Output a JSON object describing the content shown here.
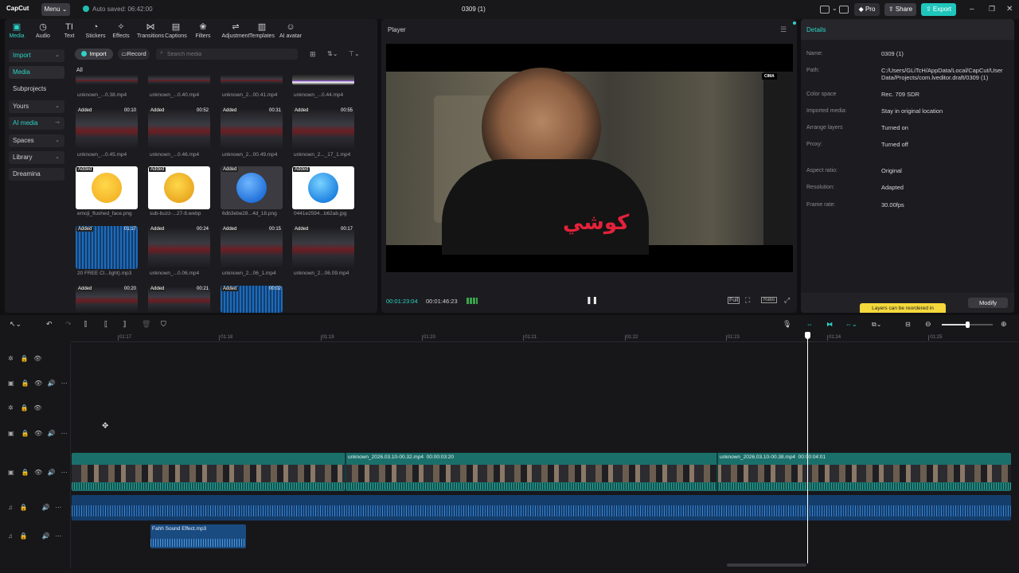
{
  "app": {
    "logo": "CapCut",
    "menu": "Menu",
    "autosave": "Auto saved: 06:42:00",
    "project_title": "0309 (1)",
    "pro": "Pro",
    "share": "Share",
    "export": "Export"
  },
  "toolbar": {
    "items": [
      {
        "label": "Media",
        "icon": "media-icon"
      },
      {
        "label": "Audio",
        "icon": "audio-icon"
      },
      {
        "label": "Text",
        "icon": "text-icon"
      },
      {
        "label": "Stickers",
        "icon": "stickers-icon"
      },
      {
        "label": "Effects",
        "icon": "effects-icon"
      },
      {
        "label": "Transitions",
        "icon": "transitions-icon"
      },
      {
        "label": "Captions",
        "icon": "captions-icon"
      },
      {
        "label": "Filters",
        "icon": "filters-icon"
      },
      {
        "label": "Adjustment",
        "icon": "adjustment-icon"
      },
      {
        "label": "Templates",
        "icon": "templates-icon"
      },
      {
        "label": "AI avatar",
        "icon": "ai-avatar-icon"
      }
    ]
  },
  "sidebar": {
    "items": [
      {
        "label": "Import"
      },
      {
        "label": "Media"
      },
      {
        "label": "Subprojects"
      },
      {
        "label": "Yours"
      },
      {
        "label": "AI media"
      },
      {
        "label": "Spaces"
      },
      {
        "label": "Library"
      },
      {
        "label": "Dreamina"
      }
    ]
  },
  "media": {
    "import": "Import",
    "record": "Record",
    "search_placeholder": "Search media",
    "filter_all": "All",
    "row0": [
      "unknown_...0.38.mp4",
      "unknown_...0.40.mp4",
      "unknown_2...00.41.mp4",
      "unknown_...0.44.mp4"
    ],
    "items": [
      {
        "name": "unknown_...0.45.mp4",
        "dur": "00:10",
        "kind": "video"
      },
      {
        "name": "unknown_...0.46.mp4",
        "dur": "00:52",
        "kind": "video"
      },
      {
        "name": "unknown_2...00.49.mp4",
        "dur": "00:31",
        "kind": "video"
      },
      {
        "name": "unknown_2..._17_1.mp4",
        "dur": "00:55",
        "kind": "video"
      },
      {
        "name": "emoji_flushed_face.png",
        "dur": "",
        "kind": "emoji"
      },
      {
        "name": "sub-buzz-...27-8.webp",
        "dur": "",
        "kind": "emoji"
      },
      {
        "name": "6db3ebe28...4d_18.png",
        "dur": "",
        "kind": "emoji"
      },
      {
        "name": "0441e2594...b62ab.jpg",
        "dur": "",
        "kind": "emoji"
      },
      {
        "name": "20 FREE Cl...light).mp3",
        "dur": "01:17",
        "kind": "audio"
      },
      {
        "name": "unknown_...0.06.mp4",
        "dur": "00:24",
        "kind": "video"
      },
      {
        "name": "unknown_2...06_1.mp4",
        "dur": "00:15",
        "kind": "video"
      },
      {
        "name": "unknown_2...06.09.mp4",
        "dur": "00:17",
        "kind": "video"
      },
      {
        "name": "",
        "dur": "00:20",
        "kind": "video"
      },
      {
        "name": "",
        "dur": "00:21",
        "kind": "video"
      },
      {
        "name": "",
        "dur": "00:02",
        "kind": "audio"
      }
    ],
    "added_badge": "Added"
  },
  "player": {
    "title": "Player",
    "current_time": "00:01:23:04",
    "total_time": "00:01:46:23",
    "overlay_text": "كوشي",
    "corner_tag": "CIMA"
  },
  "details": {
    "title": "Details",
    "rows": [
      {
        "label": "Name:",
        "value": "0309 (1)"
      },
      {
        "label": "Path:",
        "value": "C:/Users/GLiTcH/AppData/Local/CapCut/User Data/Projects/com.lveditor.draft/0309 (1)"
      },
      {
        "label": "Color space",
        "value": "Rec. 709 SDR"
      },
      {
        "label": "Imported media:",
        "value": "Stay in original location"
      },
      {
        "label": "Arrange layers",
        "value": "Turned on"
      },
      {
        "label": "Proxy:",
        "value": "Turned off"
      },
      {
        "label": "Aspect ratio:",
        "value": "Original"
      },
      {
        "label": "Resolution:",
        "value": "Adapted"
      },
      {
        "label": "Frame rate:",
        "value": "30.00fps"
      }
    ],
    "tooltip": "Layers can be reordered in",
    "modify": "Modify"
  },
  "timeline": {
    "ticks": [
      "01:17",
      "01:18",
      "01:19",
      "01:20",
      "01:21",
      "01:22",
      "01:23",
      "01:24",
      "01:25"
    ],
    "clips": [
      {
        "name": "unknown_2026.03.10-00.32.mp4",
        "duration": "00:00:03:20"
      },
      {
        "name": "unknown_2026.03.10-00.38.mp4",
        "duration": "00:00:04:01"
      }
    ],
    "sound_clip": "Fahh Sound Effect.mp3"
  },
  "colors": {
    "accent": "#2ed3c6",
    "clip_teal": "#1b6f6a",
    "audio_blue": "#1c5aa0",
    "tooltip_yellow": "#f4d83c"
  }
}
